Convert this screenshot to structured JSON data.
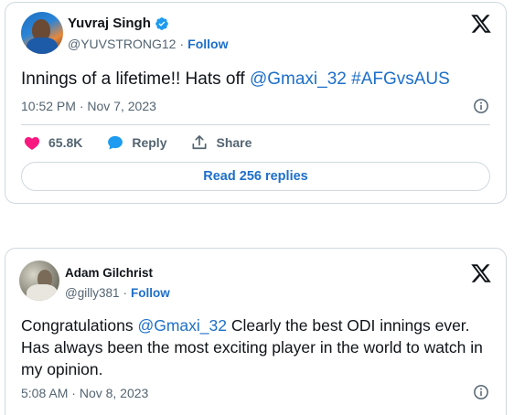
{
  "tweet1": {
    "author_name": "Yuvraj Singh",
    "handle": "@YUVSTRONG12",
    "separator": "·",
    "follow_label": "Follow",
    "text_prefix": "Innings of a lifetime!! Hats off ",
    "mention": "@Gmaxi_32",
    "hashtag": "#AFGvsAUS",
    "time": "10:52 PM",
    "date": "Nov 7, 2023",
    "likes": "65.8K",
    "reply_label": "Reply",
    "share_label": "Share",
    "read_replies_label": "Read 256 replies",
    "colors": {
      "like": "#f91880",
      "reply": "#1d9bf0",
      "link": "#1d6fc9",
      "verified": "#1d9bf0"
    }
  },
  "tweet2": {
    "author_name": "Adam Gilchrist",
    "handle": "@gilly381",
    "separator": "·",
    "follow_label": "Follow",
    "text_prefix": "Congratulations ",
    "mention": "@Gmaxi_32",
    "text_suffix": " Clearly the best ODI innings ever. Has always been the most exciting player in the world to watch in my opinion.",
    "time": "5:08 AM",
    "date": "Nov 8, 2023"
  },
  "icons": {
    "x_logo": "x-logo-icon",
    "verified": "verified-badge-icon",
    "info": "info-icon",
    "heart": "heart-icon",
    "reply": "reply-bubble-icon",
    "share": "share-icon"
  }
}
